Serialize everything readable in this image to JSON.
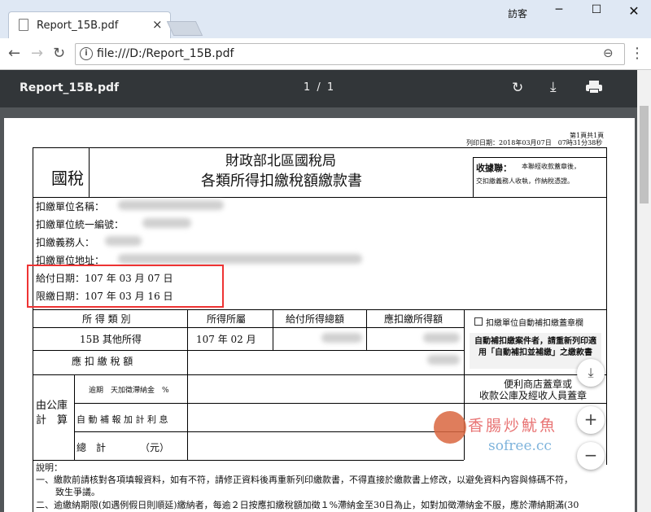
{
  "browser": {
    "tab_title": "Report_15B.pdf",
    "tab_close": "×",
    "window_user": "訪客",
    "url": "file:///D:/Report_15B.pdf"
  },
  "pdf_toolbar": {
    "file_name": "Report_15B.pdf",
    "page_indicator": "1 / 1"
  },
  "document": {
    "page_count": "第1頁共1頁",
    "print_date": "列印日期：2018年03月07日　07時31分38秒",
    "tax_type": "國稅",
    "title_line1": "財政部北區國稅局",
    "title_line2": "各類所得扣繳稅額繳款書",
    "receipt_title": "收據聯：",
    "receipt_text1": "本聯經收款蓋章後，",
    "receipt_text2": "交扣繳義務人收執，作納稅憑證。",
    "field_unit_name": "扣繳單位名稱：",
    "field_unit_id": "扣繳單位統一編號：",
    "field_obligor": "扣繳義務人：",
    "field_address": "扣繳單位地址：",
    "pay_date": "給付日期：107 年 03 月 07 日",
    "deadline": "限繳日期：107 年 03 月 16 日",
    "col_income_type": "所 得 類 別",
    "col_income_period": "所得所屬",
    "col_total_paid": "給付所得總額",
    "col_tax_withheld": "應扣繳所得額",
    "auto_stamp_label": "扣繳單位自動補扣繳蓋章欄",
    "row_income_type": "15B 其他所得",
    "row_period": "107 年 02 月",
    "auto_notice": "自動補扣繳案件者，請重新列印適用「自動補扣並補繳」之繳款書",
    "tax_due_label": "應 扣 繳 稅 額",
    "stamp_label_1": "便利商店蓋章或",
    "stamp_label_2": "收款公庫及經收人員蓋章",
    "treasury_label": "由公庫計　算",
    "late_fee": "逾期　天加徵滯納金　%",
    "auto_interest": "自 動 補 報 加 計 利 息",
    "total": "總　計　　　　（元）",
    "note_title": "說明：",
    "note_1": "一、繳款前請核對各項填報資料，如有不符，請修正資料後再重新列印繳款書，不得直接於繳款書上修改，以避免資料內容與條碼不符，",
    "note_1b": "致生爭議。",
    "note_2": "二、逾繳納期限(如遇例假日則順延)繳納者，每逾２日按應扣繳稅額加徵１%滯納金至30日為止，如對加徵滯納金不服，應於滯納期滿(30"
  },
  "watermark": {
    "text_cn": "香腸炒魷魚",
    "text_en": "sofree.cc"
  },
  "zoom_controls": {
    "fit": "⤓",
    "zoom_in": "+",
    "zoom_out": "−"
  },
  "colors": {
    "pdf_toolbar_bg": "#323639",
    "viewer_bg": "#525659",
    "highlight": "#e33333"
  }
}
